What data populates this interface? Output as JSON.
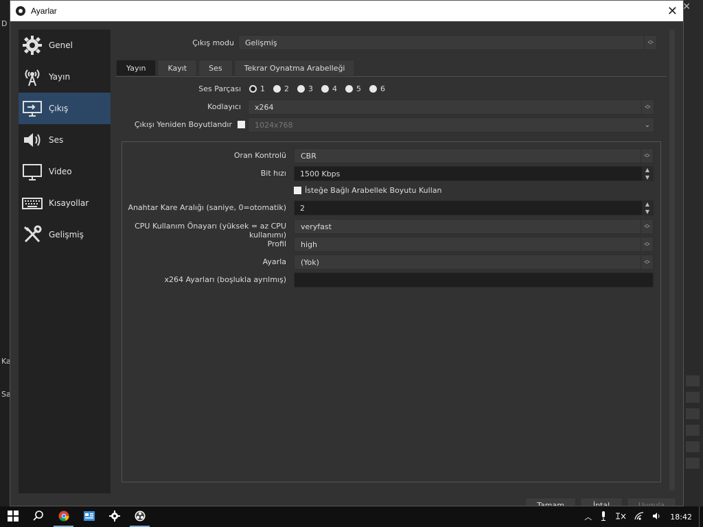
{
  "window": {
    "title": "Ayarlar",
    "close_glyph": "✕"
  },
  "background": {
    "close_glyph": "✕",
    "top_left_char": "D",
    "ka": "Ka",
    "sa": "Sa"
  },
  "sidebar": {
    "items": [
      {
        "label": "Genel",
        "icon": "gear-icon"
      },
      {
        "label": "Yayın",
        "icon": "broadcast-antenna-icon"
      },
      {
        "label": "Çıkış",
        "icon": "monitor-output-icon"
      },
      {
        "label": "Ses",
        "icon": "speaker-icon"
      },
      {
        "label": "Video",
        "icon": "monitor-icon"
      },
      {
        "label": "Kısayollar",
        "icon": "keyboard-icon"
      },
      {
        "label": "Gelişmiş",
        "icon": "tools-icon"
      }
    ],
    "active_index": 2
  },
  "output_mode": {
    "label": "Çıkış modu",
    "value": "Gelişmiş"
  },
  "tabs": [
    {
      "label": "Yayın",
      "active": true
    },
    {
      "label": "Kayıt",
      "active": false
    },
    {
      "label": "Ses",
      "active": false
    },
    {
      "label": "Tekrar Oynatma Arabelleği",
      "active": false
    }
  ],
  "audio_track": {
    "label": "Ses Parçası",
    "options": [
      "1",
      "2",
      "3",
      "4",
      "5",
      "6"
    ],
    "selected": "1"
  },
  "encoder": {
    "label": "Kodlayıcı",
    "value": "x264"
  },
  "rescale": {
    "label": "Çıkışı Yeniden Boyutlandır",
    "value": "1024x768"
  },
  "encoder_settings": {
    "rate_control": {
      "label": "Oran Kontrolü",
      "value": "CBR"
    },
    "bitrate": {
      "label": "Bit hızı",
      "value": "1500 Kbps"
    },
    "custom_buffer": {
      "label": "İsteğe Bağlı Arabellek Boyutu Kullan"
    },
    "keyframe": {
      "label": "Anahtar Kare Aralığı (saniye, 0=otomatik)",
      "value": "2"
    },
    "cpu_preset": {
      "label": "CPU Kullanım Önayarı (yüksek = az CPU kullanımı)",
      "value": "veryfast"
    },
    "profile": {
      "label": "Profil",
      "value": "high"
    },
    "tune": {
      "label": "Ayarla",
      "value": "(Yok)"
    },
    "x264_options": {
      "label": "x264 Ayarları (boşlukla ayrılmış)",
      "value": ""
    }
  },
  "buttons": {
    "ok": "Tamam",
    "cancel": "İptal",
    "apply": "Uygula"
  },
  "taskbar": {
    "time": "18:42"
  }
}
